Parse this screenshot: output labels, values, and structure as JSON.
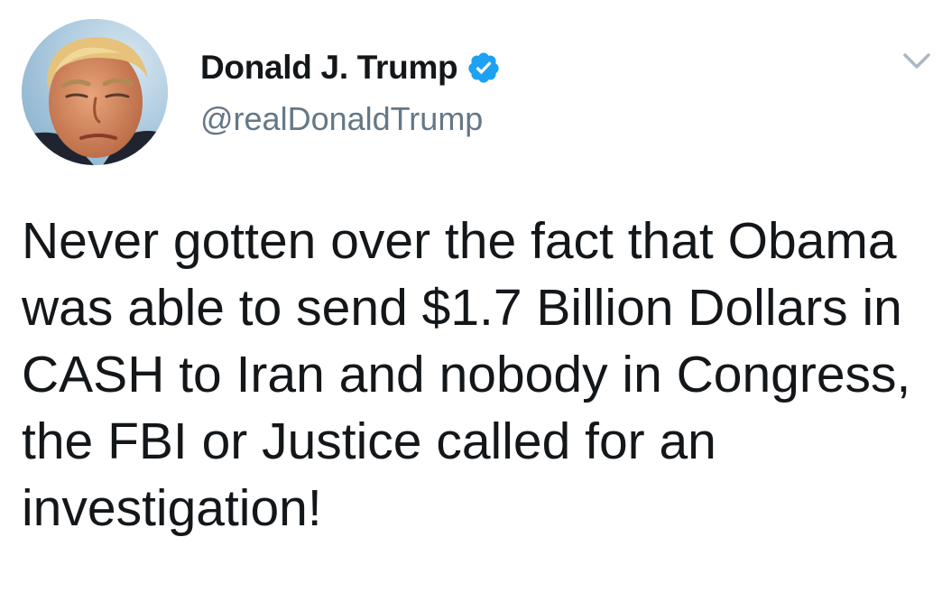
{
  "author": {
    "display_name": "Donald J. Trump",
    "handle": "@realDonaldTrump",
    "verified": true,
    "avatar_icon": "profile-photo",
    "verified_icon": "verified-badge-icon"
  },
  "menu": {
    "icon": "chevron-down-icon"
  },
  "tweet": {
    "text": "Never gotten over the fact that Obama was able to send $1.7 Billion Dollars in CASH to Iran and nobody in Congress, the FBI or Justice called for an investigation!"
  },
  "colors": {
    "name": "#14171a",
    "handle": "#657786",
    "verified_badge": "#1da1f2",
    "caret": "#aab8c2",
    "background": "#ffffff"
  }
}
